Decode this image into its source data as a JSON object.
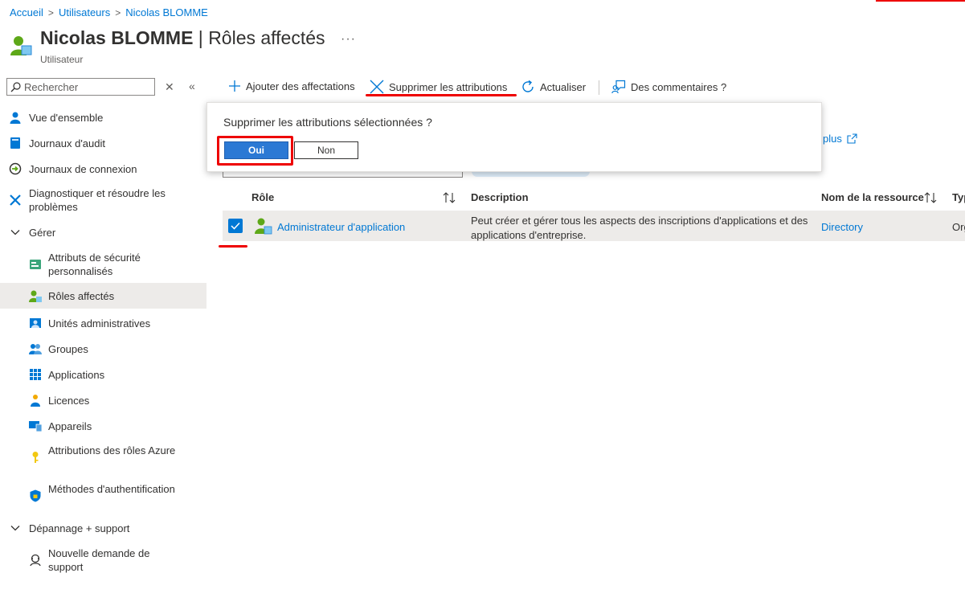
{
  "breadcrumb": [
    "Accueil",
    "Utilisateurs",
    "Nicolas BLOMME"
  ],
  "header": {
    "name": "Nicolas BLOMME",
    "separator": " | ",
    "page": "Rôles affectés",
    "subtitle": "Utilisateur",
    "more": "···"
  },
  "search": {
    "placeholder": "Rechercher"
  },
  "sidebar": {
    "items": [
      {
        "label": "Vue d'ensemble",
        "icon": "user-icon"
      },
      {
        "label": "Journaux d'audit",
        "icon": "audit-log-icon"
      },
      {
        "label": "Journaux de connexion",
        "icon": "sign-in-log-icon"
      },
      {
        "label": "Diagnostiquer et résoudre les problèmes",
        "icon": "wrench-icon"
      },
      {
        "label": "Gérer",
        "icon": "chevron-down-icon"
      },
      {
        "label": "Attributs de sécurité personnalisés",
        "icon": "security-attributes-icon"
      },
      {
        "label": "Rôles affectés",
        "icon": "assigned-roles-icon",
        "selected": true
      },
      {
        "label": "Unités administratives",
        "icon": "admin-units-icon"
      },
      {
        "label": "Groupes",
        "icon": "groups-icon"
      },
      {
        "label": "Applications",
        "icon": "applications-icon"
      },
      {
        "label": "Licences",
        "icon": "licenses-icon"
      },
      {
        "label": "Appareils",
        "icon": "devices-icon"
      },
      {
        "label": "Attributions des rôles Azure",
        "icon": "key-icon"
      },
      {
        "label": "Méthodes d'authentification",
        "icon": "shield-icon"
      },
      {
        "label": "Dépannage + support",
        "icon": "chevron-down-icon"
      },
      {
        "label": "Nouvelle demande de support",
        "icon": "support-icon"
      }
    ]
  },
  "toolbar": {
    "add": "Ajouter des affectations",
    "remove": "Supprimer les attributions",
    "refresh": "Actualiser",
    "feedback": "Des commentaires ?"
  },
  "dialog": {
    "question": "Supprimer les attributions sélectionnées ?",
    "yes": "Oui",
    "no": "Non"
  },
  "behind": {
    "more_link": "plus"
  },
  "table": {
    "headers": [
      "Rôle",
      "Description",
      "Nom de la ressource",
      "Typ"
    ],
    "rows": [
      {
        "role": "Administrateur d'application",
        "description_line1": "Peut créer et gérer tous les aspects des inscriptions d'applications et des",
        "description_line2": "applications d'entreprise.",
        "resource": "Directory",
        "type": "Org",
        "checked": true
      }
    ]
  },
  "colors": {
    "accent": "#0078d4",
    "highlight": "#e00000",
    "selected_bg": "#edebe9",
    "button": "#2b79d4"
  }
}
